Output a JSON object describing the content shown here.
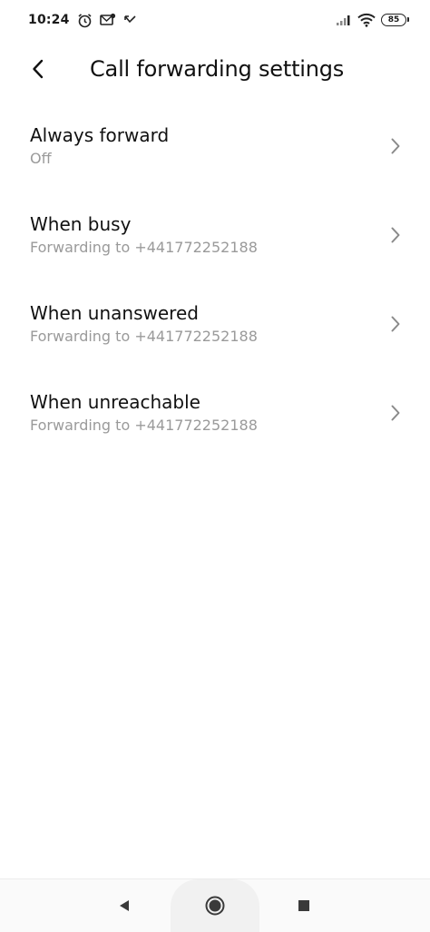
{
  "status_bar": {
    "time": "10:24",
    "battery": "85"
  },
  "header": {
    "title": "Call forwarding settings"
  },
  "items": [
    {
      "title": "Always forward",
      "subtitle": "Off"
    },
    {
      "title": "When busy",
      "subtitle": "Forwarding to +441772252188"
    },
    {
      "title": "When unanswered",
      "subtitle": "Forwarding to +441772252188"
    },
    {
      "title": "When unreachable",
      "subtitle": "Forwarding to +441772252188"
    }
  ],
  "icons": {
    "status_left": [
      "alarm-icon",
      "notification-icon",
      "missed-call-icon"
    ],
    "status_right": [
      "signal-icon",
      "wifi-icon",
      "battery-icon"
    ],
    "nav": [
      "back-nav-icon",
      "home-nav-icon",
      "recents-nav-icon"
    ]
  }
}
